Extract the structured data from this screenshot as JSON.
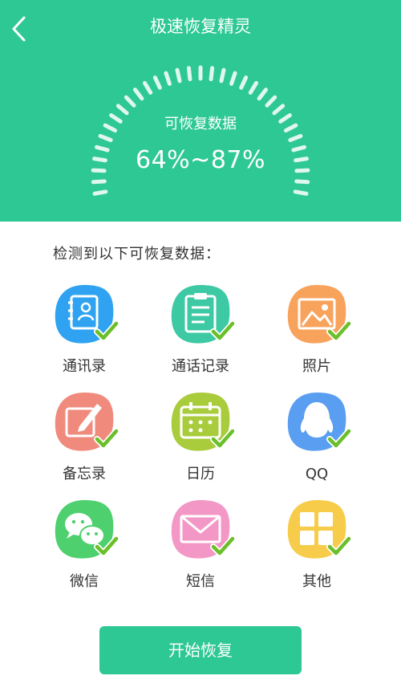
{
  "header": {
    "title": "极速恢复精灵",
    "back_icon": "chevron-left-icon",
    "background": "#2ec894"
  },
  "gauge": {
    "label": "可恢复数据",
    "value": "64%~87%"
  },
  "section_title": "检测到以下可恢复数据：",
  "items": [
    {
      "label": "通讯录",
      "icon": "contacts-book-icon",
      "color": "#2fa3f1"
    },
    {
      "label": "通话记录",
      "icon": "call-log-clipboard-icon",
      "color": "#3dc9a3"
    },
    {
      "label": "照片",
      "icon": "photo-icon",
      "color": "#f8a35c"
    },
    {
      "label": "备忘录",
      "icon": "memo-pencil-icon",
      "color": "#f08a7d"
    },
    {
      "label": "日历",
      "icon": "calendar-icon",
      "color": "#a8cc3c"
    },
    {
      "label": "QQ",
      "icon": "qq-penguin-icon",
      "color": "#5a9ef2"
    },
    {
      "label": "微信",
      "icon": "wechat-icon",
      "color": "#4fd06e"
    },
    {
      "label": "短信",
      "icon": "envelope-icon",
      "color": "#f398c6"
    },
    {
      "label": "其他",
      "icon": "grid-squares-icon",
      "color": "#f7cc4a"
    }
  ],
  "check_color": "#6bbf2a",
  "start_button": {
    "label": "开始恢复"
  }
}
